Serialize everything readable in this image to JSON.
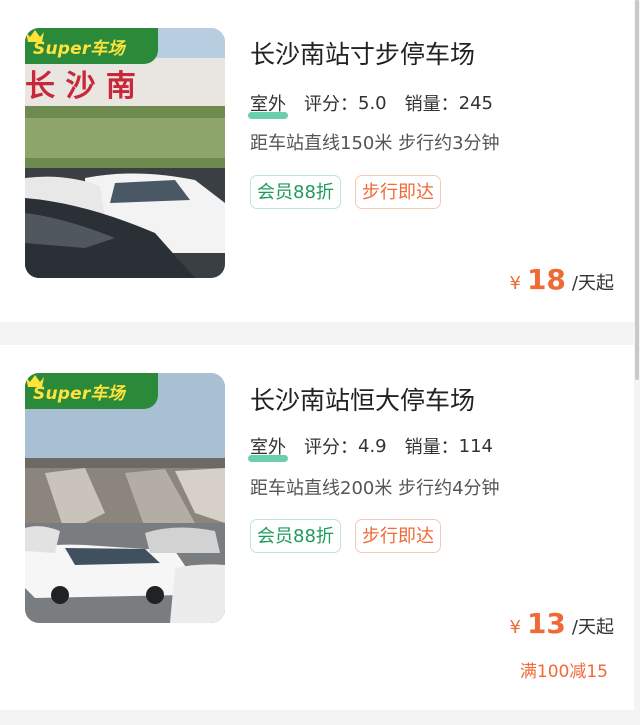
{
  "colors": {
    "accent_orange": "#f06a35",
    "member_green": "#1f9a5c",
    "badge_green": "#2a8a3a",
    "badge_yellow": "#ffe23a"
  },
  "listings": [
    {
      "badge": "Super车场",
      "badge_icon": "crown-icon",
      "title": "长沙南站寸步停车场",
      "type": "室外",
      "rating_label": "评分：",
      "rating": "5.0",
      "sales_label": "销量：",
      "sales": "245",
      "distance": "距车站直线150米 步行约3分钟",
      "tags": [
        "会员88折",
        "步行即达"
      ],
      "currency": "¥",
      "price": "18",
      "price_unit": "/天起",
      "photo_sign_text": "长 沙 南"
    },
    {
      "badge": "Super车场",
      "badge_icon": "crown-icon",
      "title": "长沙南站恒大停车场",
      "type": "室外",
      "rating_label": "评分：",
      "rating": "4.9",
      "sales_label": "销量：",
      "sales": "114",
      "distance": "距车站直线200米 步行约4分钟",
      "tags": [
        "会员88折",
        "步行即达"
      ],
      "currency": "¥",
      "price": "13",
      "price_unit": "/天起",
      "promo": "满100减15"
    }
  ]
}
